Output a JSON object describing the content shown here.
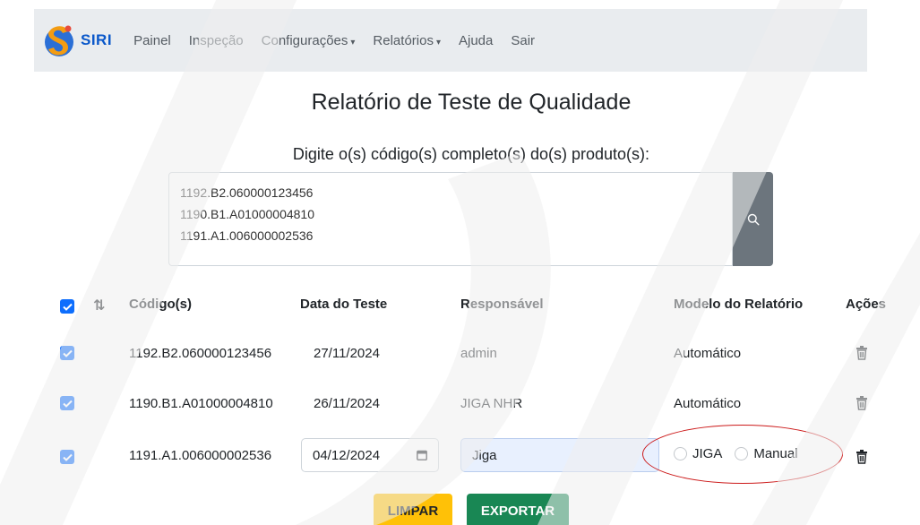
{
  "navbar": {
    "brand": "SIRI",
    "items": [
      {
        "label": "Painel",
        "dropdown": false
      },
      {
        "label": "Inspeção",
        "dropdown": false
      },
      {
        "label": "Configurações",
        "dropdown": true
      },
      {
        "label": "Relatórios",
        "dropdown": true
      },
      {
        "label": "Ajuda",
        "dropdown": false
      },
      {
        "label": "Sair",
        "dropdown": false
      }
    ],
    "caret": "▾"
  },
  "page": {
    "title": "Relatório de Teste de Qualidade",
    "subtitle": "Digite o(s) código(s) completo(s) do(s) produto(s):"
  },
  "search": {
    "codes_value": "1192.B2.060000123456\n1190.B1.A01000004810\n1191.A1.006000002536",
    "icon": "search-icon"
  },
  "table": {
    "sort_glyph": "⇅",
    "headers": {
      "code": "Código(s)",
      "date": "Data do Teste",
      "responsible": "Responsável",
      "model": "Modelo do Relatório",
      "actions": "Ações"
    },
    "rows": [
      {
        "code": "1192.B2.060000123456",
        "date": "27/11/2024",
        "responsible": "admin",
        "model": "Automático",
        "checked": true
      },
      {
        "code": "1190.B1.A01000004810",
        "date": "26/11/2024",
        "responsible": "JIGA NHR",
        "model": "Automático",
        "checked": true
      },
      {
        "code": "1191.A1.006000002536",
        "date": "04/12/2024",
        "responsible": "Jiga",
        "model_options": [
          "JIGA",
          "Manual"
        ],
        "checked": true
      }
    ]
  },
  "buttons": {
    "clear": "LIMPAR",
    "export": "EXPORTAR"
  },
  "colors": {
    "navbar_bg": "#e9ecef",
    "primary": "#0d6efd",
    "warning": "#ffc107",
    "success": "#198754",
    "secondary": "#6c757d",
    "annotation": "#cc1a1a",
    "watermark": "#eeeeee"
  }
}
